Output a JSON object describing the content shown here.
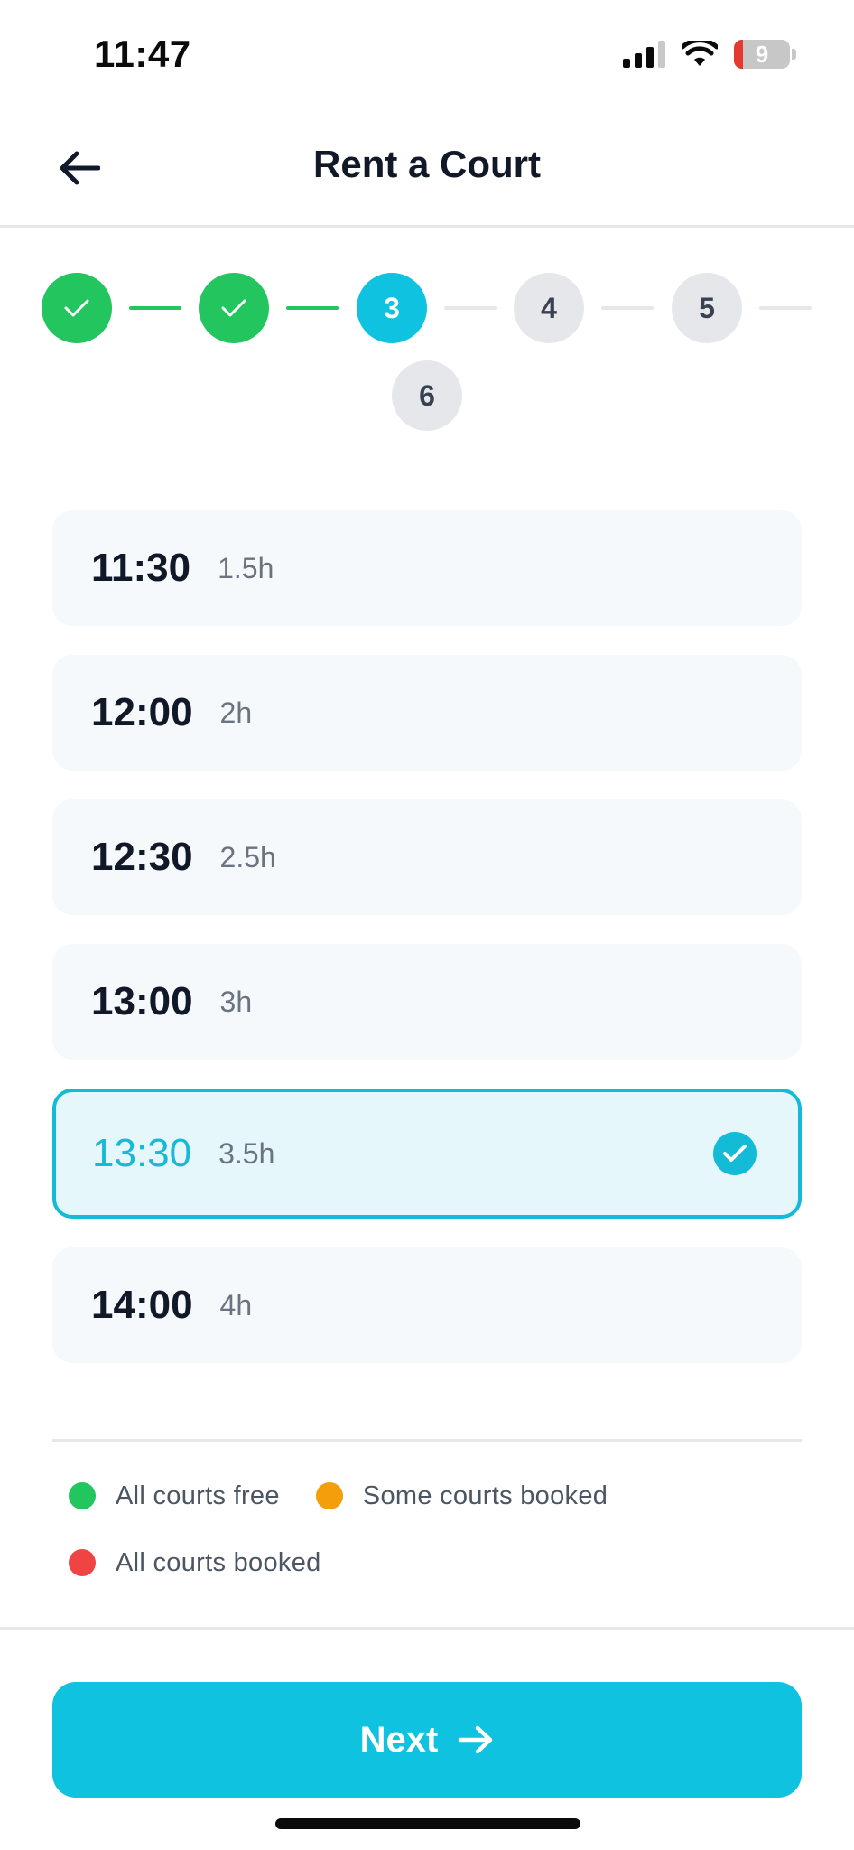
{
  "status_bar": {
    "time": "11:47",
    "battery_level": "9",
    "icons": [
      "signal-icon",
      "wifi-icon",
      "battery-icon"
    ]
  },
  "header": {
    "title": "Rent a Court",
    "back_icon": "arrow-left-icon"
  },
  "stepper": {
    "steps": [
      {
        "label": "",
        "state": "done"
      },
      {
        "label": "",
        "state": "done"
      },
      {
        "label": "3",
        "state": "current"
      },
      {
        "label": "4",
        "state": "todo"
      },
      {
        "label": "5",
        "state": "todo"
      },
      {
        "label": "6",
        "state": "todo"
      }
    ]
  },
  "slots": [
    {
      "time": "11:30",
      "duration": "1.5h",
      "selected": false
    },
    {
      "time": "12:00",
      "duration": "2h",
      "selected": false
    },
    {
      "time": "12:30",
      "duration": "2.5h",
      "selected": false
    },
    {
      "time": "13:00",
      "duration": "3h",
      "selected": false
    },
    {
      "time": "13:30",
      "duration": "3.5h",
      "selected": true
    },
    {
      "time": "14:00",
      "duration": "4h",
      "selected": false
    }
  ],
  "legend": {
    "items": [
      {
        "label": "All courts free",
        "color": "#22c55e"
      },
      {
        "label": "Some courts booked",
        "color": "#f59e0b"
      },
      {
        "label": "All courts booked",
        "color": "#ef4444"
      }
    ]
  },
  "footer": {
    "next_label": "Next",
    "next_icon": "arrow-right-icon"
  },
  "colors": {
    "accent": "#0ec2e0",
    "done": "#22c55e"
  }
}
